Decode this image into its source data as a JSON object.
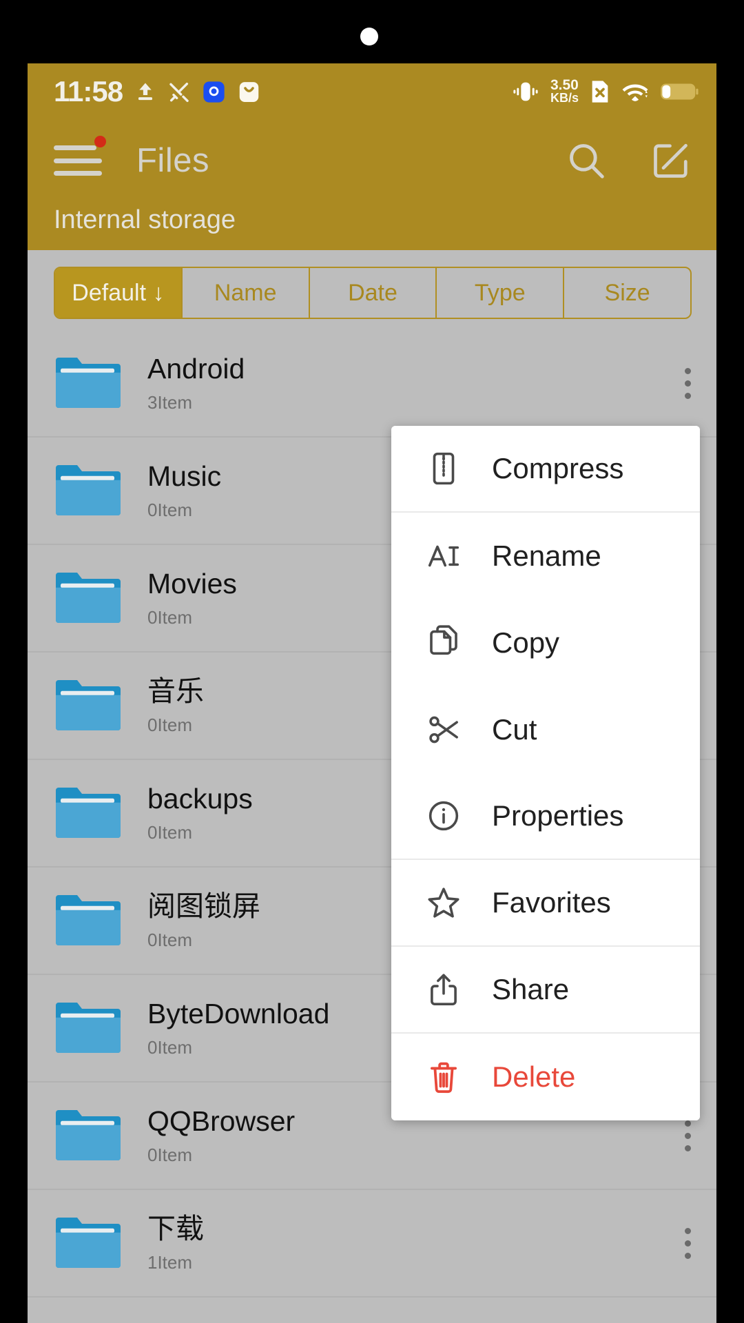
{
  "status_bar": {
    "time": "11:58",
    "left_icons": [
      "upload-arrow-icon",
      "tools-icon",
      "blue-app-icon",
      "mail-app-icon"
    ],
    "network_speed": "3.50",
    "network_unit": "KB/s",
    "right_icons": [
      "vibrate-icon",
      "no-sim-icon",
      "wifi-icon",
      "battery-icon"
    ],
    "background": "#ab8a22"
  },
  "app_bar": {
    "title": "Files",
    "menu_icon": "hamburger-menu-icon",
    "menu_badge": true,
    "search_icon": "search-icon",
    "edit_icon": "edit-icon"
  },
  "breadcrumb": {
    "path": "Internal storage"
  },
  "sort_tabs": {
    "active_index": 0,
    "items": [
      {
        "label": "Default ↓",
        "name": "default"
      },
      {
        "label": "Name",
        "name": "name"
      },
      {
        "label": "Date",
        "name": "date"
      },
      {
        "label": "Type",
        "name": "type"
      },
      {
        "label": "Size",
        "name": "size"
      }
    ]
  },
  "file_list": {
    "rows": [
      {
        "name": "Android",
        "sub": "3Item",
        "icon": "folder-icon"
      },
      {
        "name": "Music",
        "sub": "0Item",
        "icon": "folder-icon"
      },
      {
        "name": "Movies",
        "sub": "0Item",
        "icon": "folder-icon"
      },
      {
        "name": "音乐",
        "sub": "0Item",
        "icon": "folder-icon"
      },
      {
        "name": "backups",
        "sub": "0Item",
        "icon": "folder-icon"
      },
      {
        "name": "阅图锁屏",
        "sub": "0Item",
        "icon": "folder-icon"
      },
      {
        "name": "ByteDownload",
        "sub": "0Item",
        "icon": "folder-icon"
      },
      {
        "name": "QQBrowser",
        "sub": "0Item",
        "icon": "folder-icon"
      },
      {
        "name": "下载",
        "sub": "1Item",
        "icon": "folder-icon"
      }
    ]
  },
  "context_menu": {
    "items": [
      {
        "label": "Compress",
        "icon": "zip-icon",
        "danger": false,
        "divider_after": true
      },
      {
        "label": "Rename",
        "icon": "text-cursor-icon",
        "danger": false,
        "divider_after": false
      },
      {
        "label": "Copy",
        "icon": "copy-icon",
        "danger": false,
        "divider_after": false
      },
      {
        "label": "Cut",
        "icon": "scissors-icon",
        "danger": false,
        "divider_after": false
      },
      {
        "label": "Properties",
        "icon": "info-icon",
        "danger": false,
        "divider_after": true
      },
      {
        "label": "Favorites",
        "icon": "star-icon",
        "danger": false,
        "divider_after": true
      },
      {
        "label": "Share",
        "icon": "share-icon",
        "danger": false,
        "divider_after": true
      },
      {
        "label": "Delete",
        "icon": "trash-icon",
        "danger": true,
        "divider_after": false
      }
    ]
  },
  "colors": {
    "accent_gold": "#ab8a22",
    "page_bg": "#bdbdbd",
    "folder_blue": "#4ba6d4",
    "folder_tab_blue": "#1f8fc4",
    "danger_red": "#e8483a",
    "badge_red": "#d32b17"
  }
}
